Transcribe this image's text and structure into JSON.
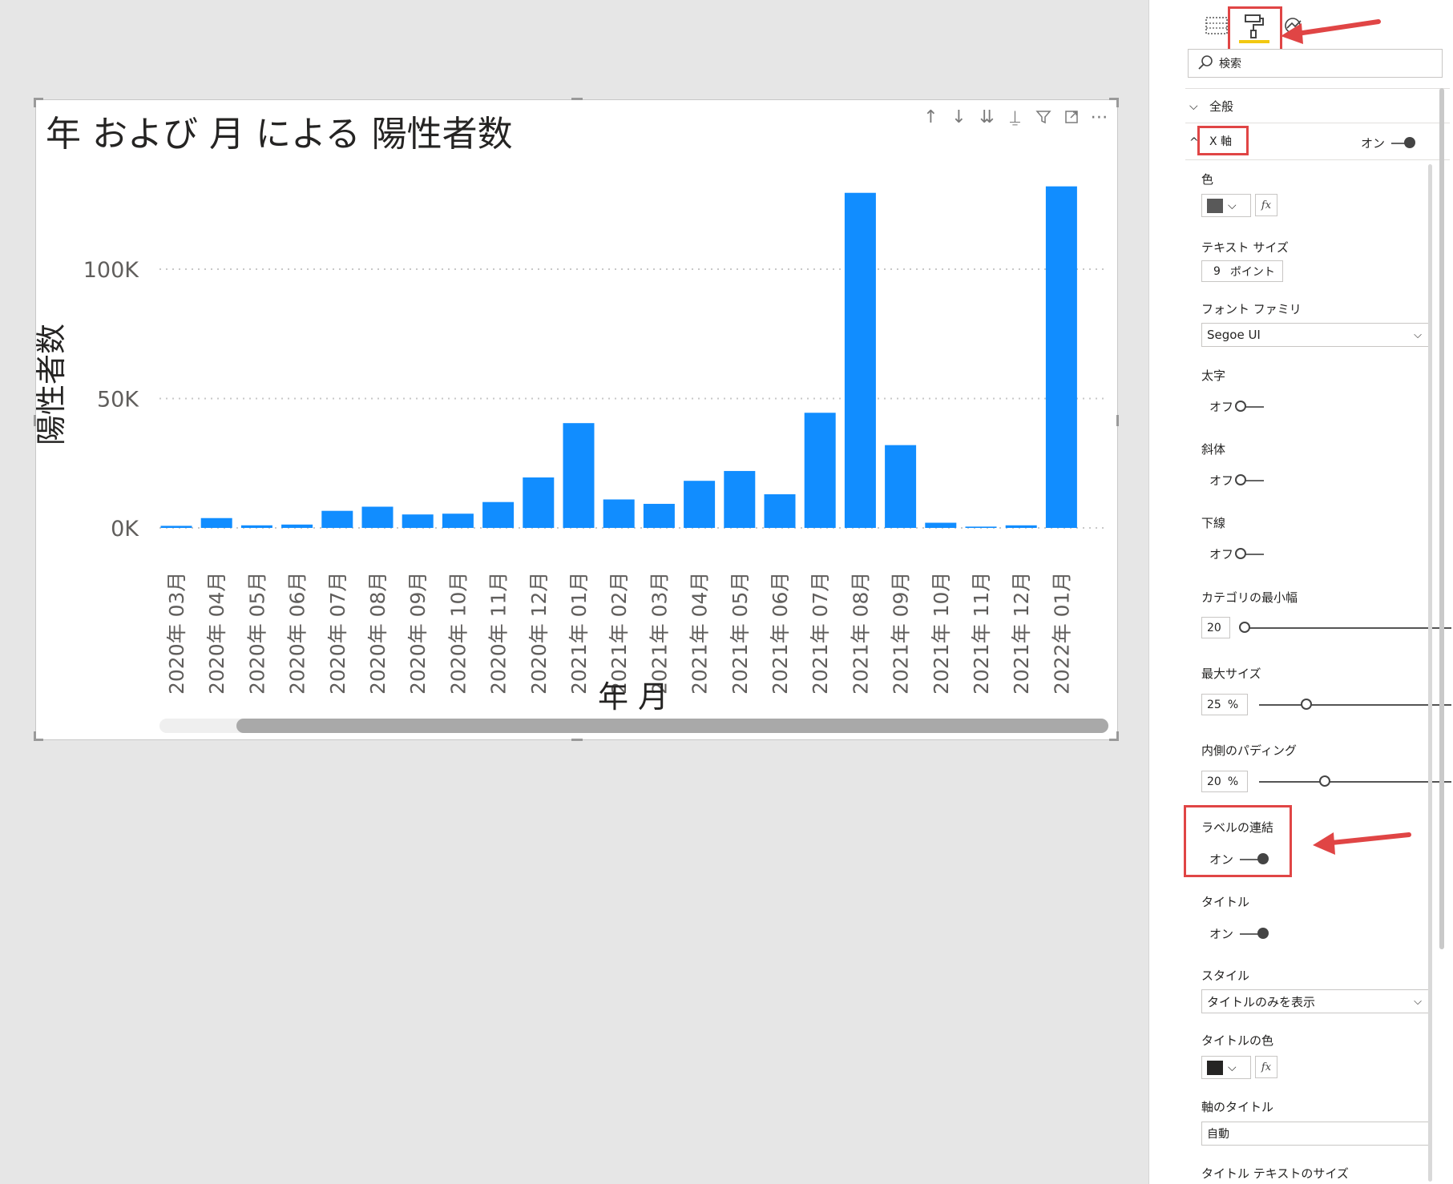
{
  "visual": {
    "title": "年 および 月 による 陽性者数",
    "header_icons": [
      "arrow-up-icon",
      "arrow-down-icon",
      "double-arrow-down-icon",
      "expand-hierarchy-icon",
      "filter-icon",
      "focus-mode-icon",
      "more-options-icon"
    ]
  },
  "chart_data": {
    "type": "bar",
    "xlabel": "年 月",
    "ylabel": "陽性者数",
    "yticks": [
      "100K",
      "50K",
      "0K"
    ],
    "ytick_values": [
      100000,
      50000,
      0
    ],
    "ylim": [
      0,
      140000
    ],
    "grid": "dotted horizontal",
    "bar_color": "#118dff",
    "categories": [
      "2020年 03月",
      "2020年 04月",
      "2020年 05月",
      "2020年 06月",
      "2020年 07月",
      "2020年 08月",
      "2020年 09月",
      "2020年 10月",
      "2020年 11月",
      "2020年 12月",
      "2021年 01月",
      "2021年 02月",
      "2021年 03月",
      "2021年 04月",
      "2021年 05月",
      "2021年 06月",
      "2021年 07月",
      "2021年 08月",
      "2021年 09月",
      "2021年 10月",
      "2021年 11月",
      "2021年 12月",
      "2022年 01月"
    ],
    "values": [
      800,
      3800,
      1000,
      1300,
      6600,
      8200,
      5200,
      5500,
      10000,
      19500,
      40500,
      11000,
      9300,
      18200,
      22000,
      13000,
      44500,
      129500,
      32000,
      2000,
      500,
      1000,
      132000
    ]
  },
  "pane": {
    "search_placeholder": "検索",
    "sections": {
      "general": "全般",
      "xaxis": "X 軸",
      "xaxis_state": "オン"
    },
    "color_label": "色",
    "color_value": "#595959",
    "fx": "fx",
    "text_size_label": "テキスト サイズ",
    "text_size_value": "9",
    "text_size_unit": "ポイント",
    "font_family_label": "フォント ファミリ",
    "font_family_value": "Segoe UI",
    "bold_label": "太字",
    "bold_state": "オフ",
    "italic_label": "斜体",
    "italic_state": "オフ",
    "underline_label": "下線",
    "underline_state": "オフ",
    "min_category_label": "カテゴリの最小幅",
    "min_category_value": "20",
    "max_size_label": "最大サイズ",
    "max_size_value": "25",
    "max_size_unit": "%",
    "inner_padding_label": "内側のパディング",
    "inner_padding_value": "20",
    "inner_padding_unit": "%",
    "concat_labels_label": "ラベルの連結",
    "concat_labels_state": "オン",
    "title_label": "タイトル",
    "title_state": "オン",
    "style_label": "スタイル",
    "style_value": "タイトルのみを表示",
    "title_color_label": "タイトルの色",
    "title_color_value": "#252423",
    "axis_title_label": "軸のタイトル",
    "axis_title_value": "自動",
    "title_text_size_label": "タイトル テキストのサイズ"
  },
  "annotations": {
    "accent": "#e04545",
    "active_tab_underline": "#f2c811"
  }
}
